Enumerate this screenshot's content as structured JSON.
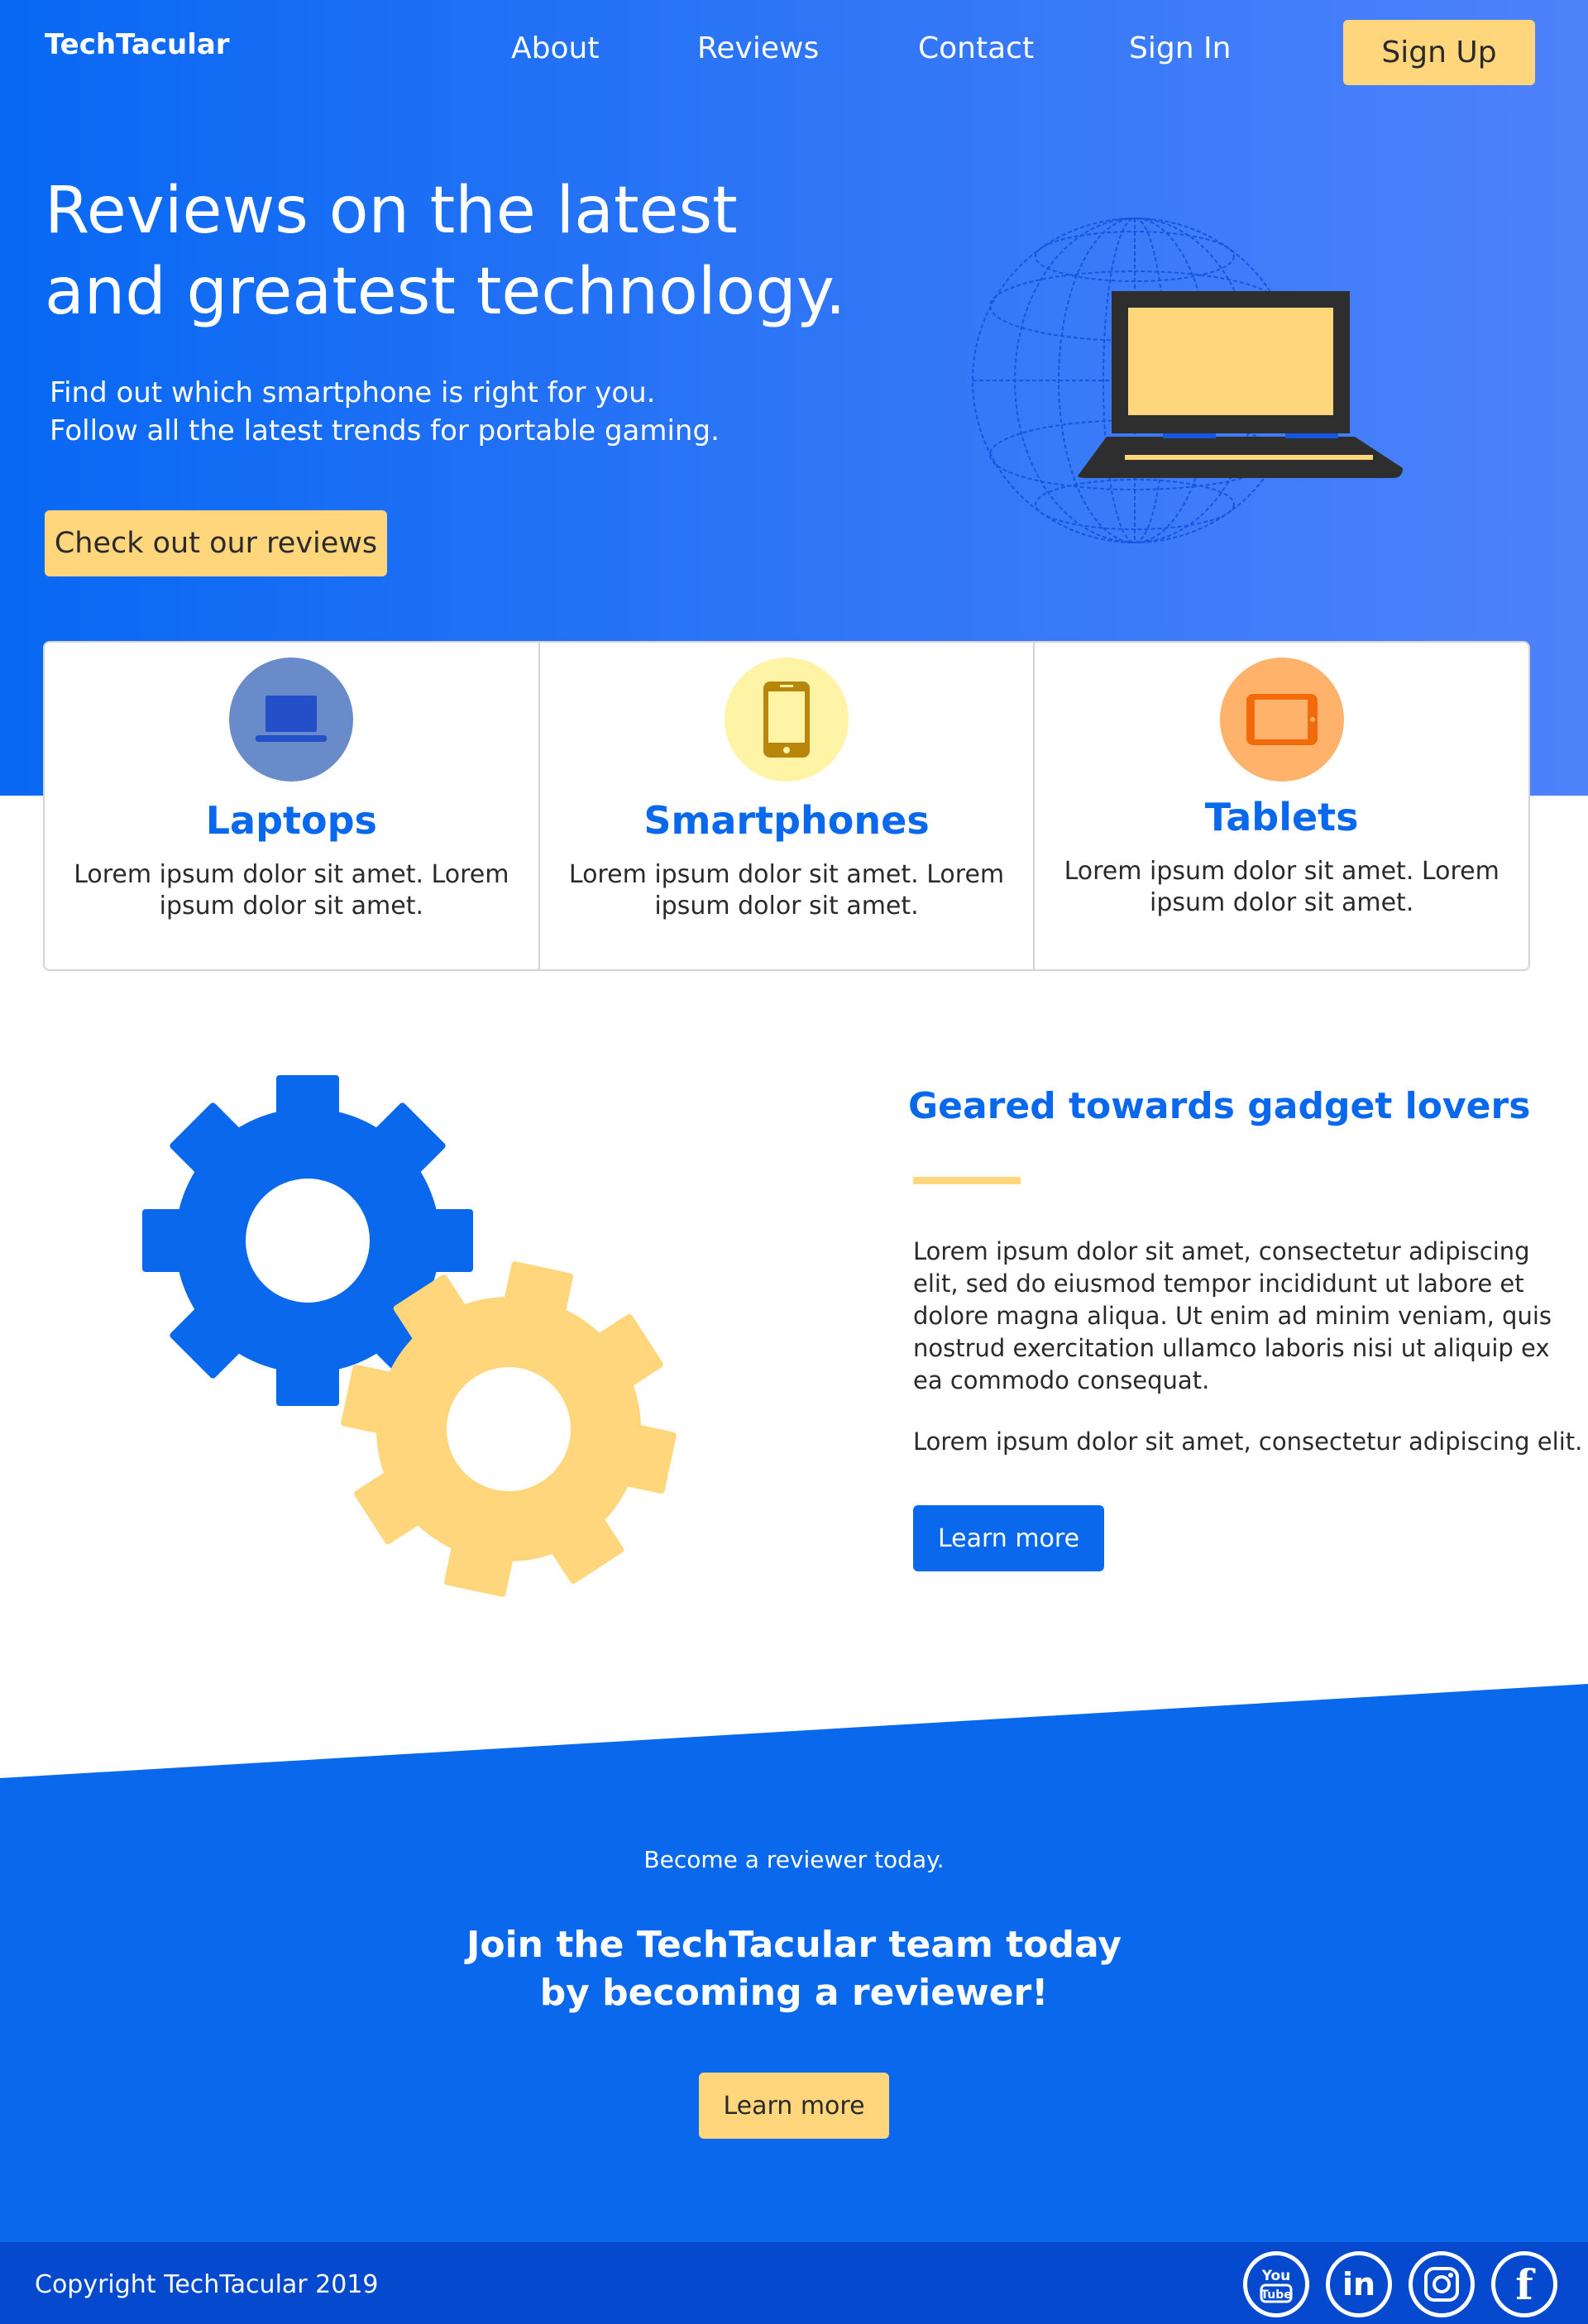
{
  "brand": {
    "logo": "TechTacular"
  },
  "nav": {
    "items": [
      "About",
      "Reviews",
      "Contact",
      "Sign In"
    ],
    "signup_label": "Sign Up"
  },
  "hero": {
    "title_lines": [
      "Reviews on the latest",
      "and greatest technology."
    ],
    "subtitle_lines": [
      "Find out which smartphone is right for you.",
      "Follow all the latest trends  for portable gaming."
    ],
    "cta_label": "Check out our reviews"
  },
  "categories": [
    {
      "title": "Laptops",
      "text": "Lorem ipsum dolor sit amet. Lorem ipsum dolor sit amet.",
      "icon": "laptop-icon",
      "circle_color": "#6a8bc9",
      "icon_color": "#2350c9"
    },
    {
      "title": "Smartphones",
      "text": "Lorem ipsum dolor sit amet. Lorem ipsum dolor sit amet.",
      "icon": "smartphone-icon",
      "circle_color": "#fff3a6",
      "icon_color": "#b8860b"
    },
    {
      "title": "Tablets",
      "text": "Lorem ipsum dolor sit amet. Lorem ipsum dolor sit amet.",
      "icon": "tablet-icon",
      "circle_color": "#ffb26a",
      "icon_color": "#f36a0c"
    }
  ],
  "feature": {
    "title": "Geared towards gadget lovers",
    "paragraph1": "Lorem ipsum dolor sit amet, consectetur adipiscing elit, sed do eiusmod tempor incididunt ut labore et dolore magna aliqua. Ut enim ad minim veniam, quis nostrud exercitation ullamco laboris nisi ut aliquip  ex ea commodo consequat.",
    "paragraph2": "Lorem ipsum dolor sit amet, consectetur adipiscing elit.",
    "button_label": "Learn more"
  },
  "join": {
    "small_text": "Become a reviewer today.",
    "title_lines": [
      "Join the TechTacular team today",
      "by becoming a reviewer!"
    ],
    "button_label": "Learn more"
  },
  "footer": {
    "copyright": "Copyright TechTacular 2019",
    "social": [
      {
        "name": "youtube-icon"
      },
      {
        "name": "linkedin-icon",
        "label": "in"
      },
      {
        "name": "instagram-icon"
      },
      {
        "name": "facebook-icon",
        "label": "f"
      }
    ]
  },
  "colors": {
    "primary_blue": "#0a68ec",
    "accent_yellow": "#ffd67b",
    "footer_blue": "#0549cf",
    "dark": "#2a2a2a"
  }
}
